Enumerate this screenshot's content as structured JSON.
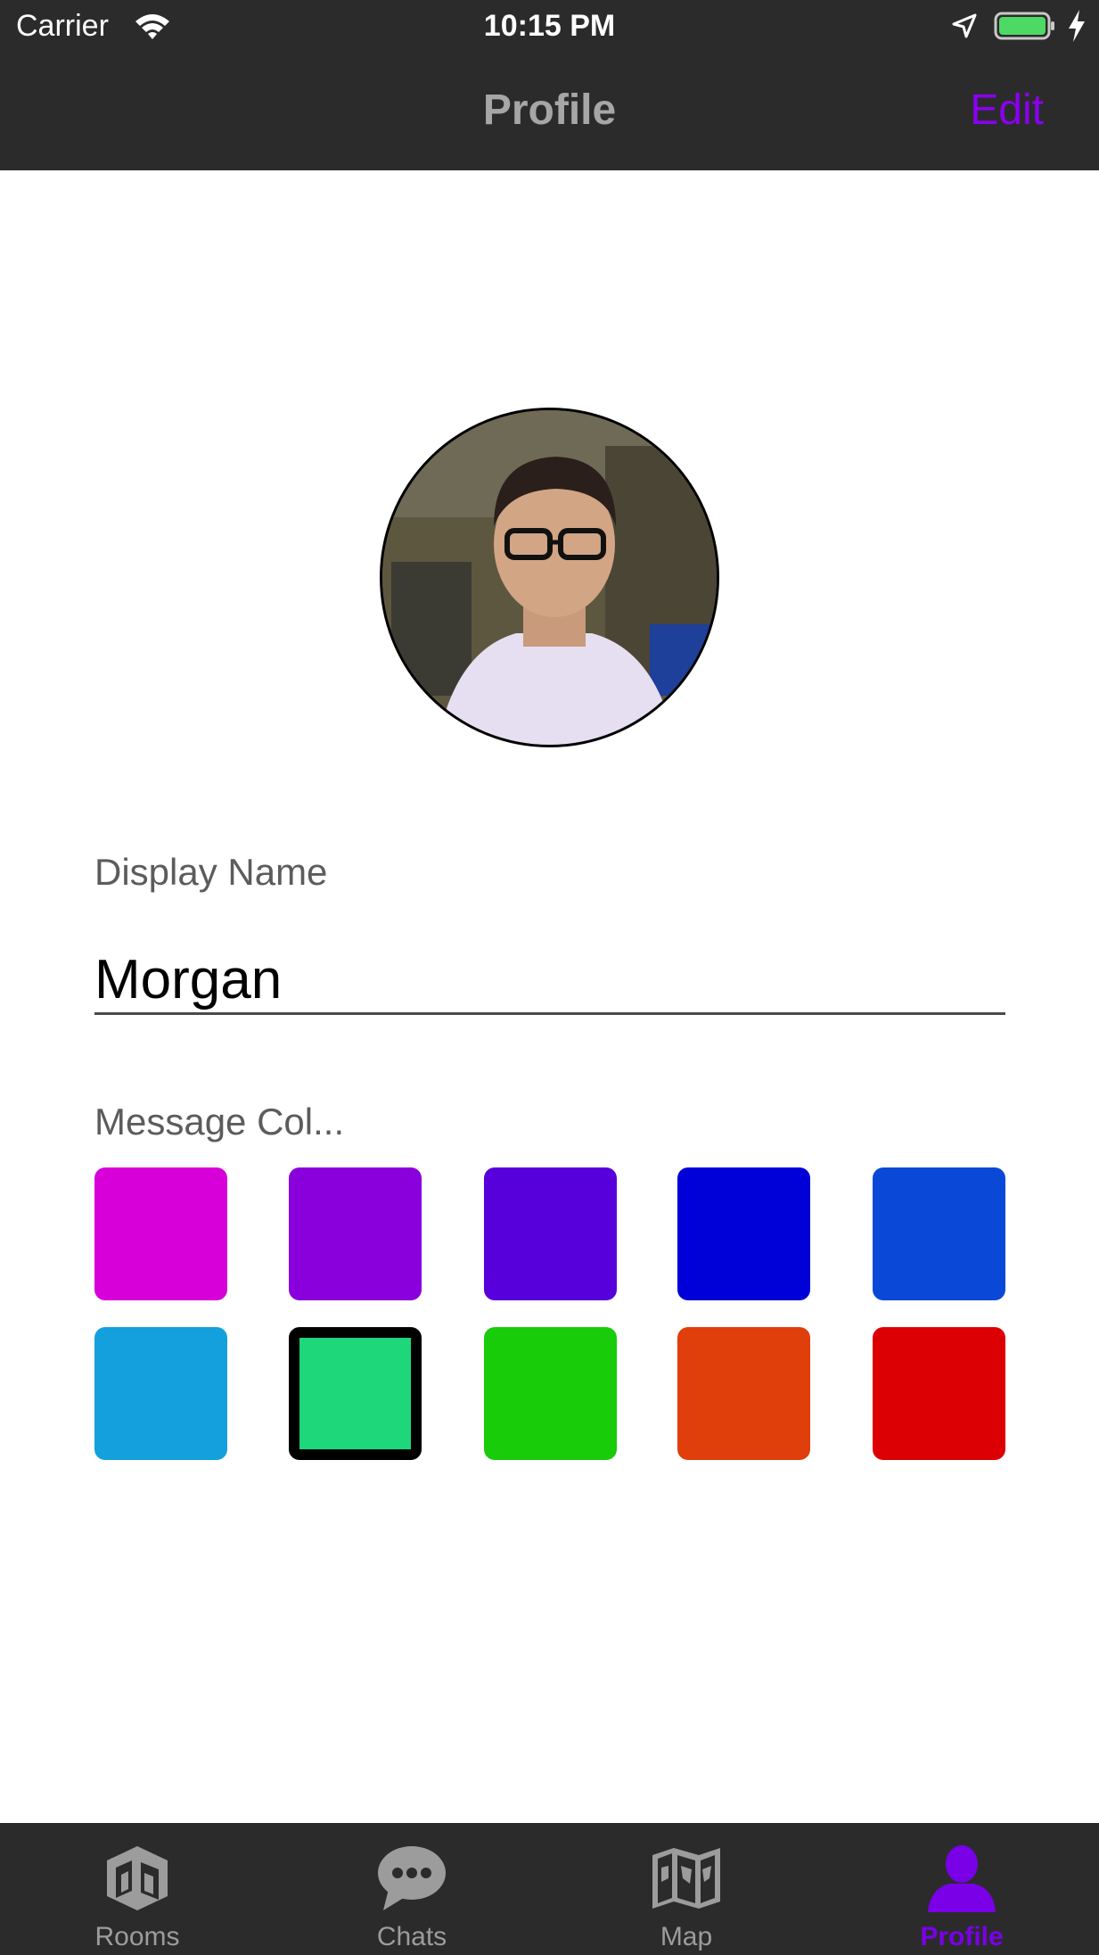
{
  "status_bar": {
    "carrier": "Carrier",
    "time": "10:15 PM"
  },
  "nav": {
    "title": "Profile",
    "edit_label": "Edit"
  },
  "profile": {
    "display_name_label": "Display Name",
    "display_name_value": "Morgan",
    "message_color_label": "Message Col...",
    "colors": [
      "#d800d8",
      "#8a00dc",
      "#5800dc",
      "#0000d8",
      "#0a48d8",
      "#14a0dc",
      "#1ed77a",
      "#18cc0a",
      "#e03e0a",
      "#dc0005"
    ],
    "selected_color": "#1ed77a"
  },
  "tabs": [
    {
      "label": "Rooms",
      "icon": "rooms-icon"
    },
    {
      "label": "Chats",
      "icon": "chats-icon"
    },
    {
      "label": "Map",
      "icon": "map-icon"
    },
    {
      "label": "Profile",
      "icon": "profile-icon"
    }
  ],
  "colors": {
    "accent": "#7a00e8",
    "bar_background": "#2b2b2b",
    "inactive_tab": "#9c9c9c"
  }
}
